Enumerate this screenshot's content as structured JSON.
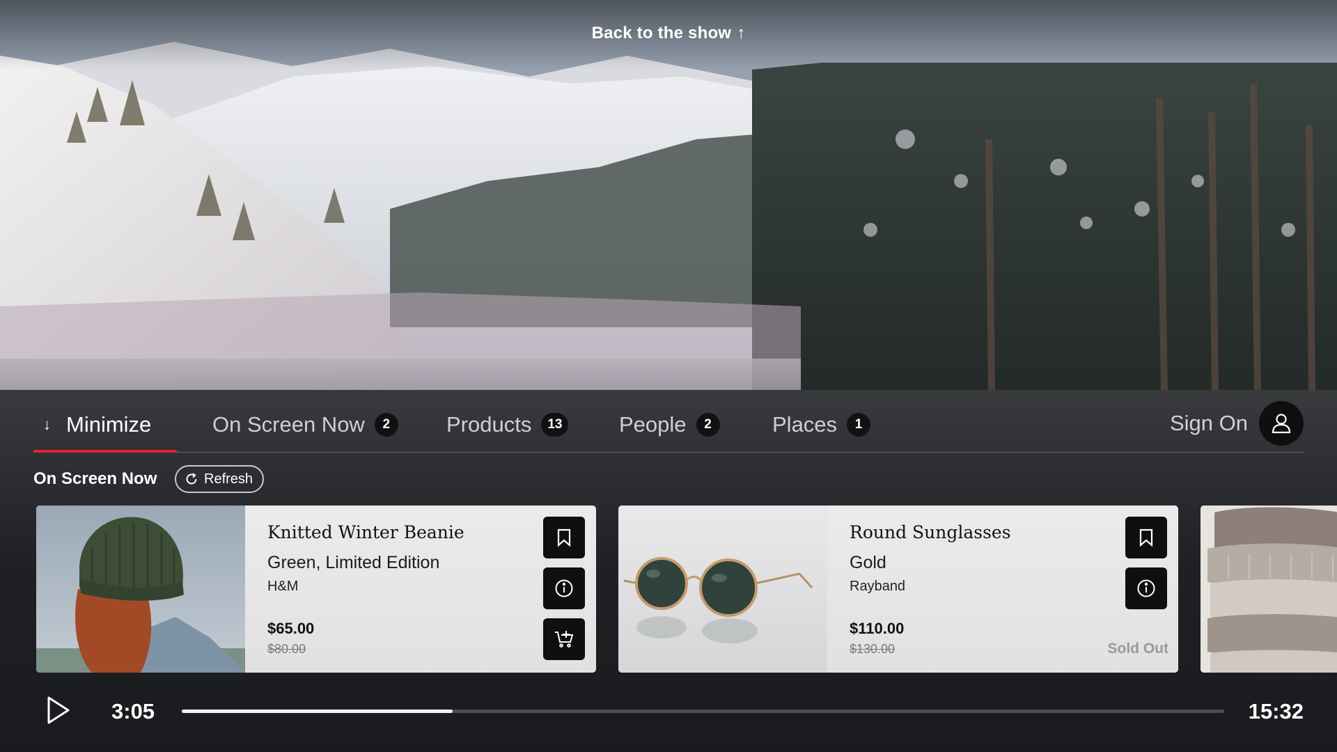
{
  "header": {
    "back_label": "Back to the show",
    "back_icon": "arrow-up-icon"
  },
  "tabs": [
    {
      "label": "Minimize",
      "icon": "arrow-down-icon",
      "active": true
    },
    {
      "label": "On Screen Now",
      "count": "2"
    },
    {
      "label": "Products",
      "count": "13"
    },
    {
      "label": "People",
      "count": "2"
    },
    {
      "label": "Places",
      "count": "1"
    }
  ],
  "account": {
    "sign_on_label": "Sign On",
    "icon": "user-icon"
  },
  "section": {
    "title": "On Screen Now",
    "refresh_label": "Refresh"
  },
  "products": [
    {
      "name": "Knitted Winter Beanie",
      "variant": "Green, Limited Edition",
      "brand": "H&M",
      "price": "$65.00",
      "old_price": "$80.00",
      "actions": [
        "bookmark-icon",
        "info-icon",
        "add-to-cart-icon"
      ]
    },
    {
      "name": "Round Sunglasses",
      "variant": "Gold",
      "brand": "Rayband",
      "price": "$110.00",
      "old_price": "$130.00",
      "status": "Sold Out",
      "actions": [
        "bookmark-icon",
        "info-icon"
      ]
    }
  ],
  "player": {
    "current_time": "3:05",
    "total_time": "15:32",
    "progress": 0.26,
    "play_icon": "play-icon"
  },
  "colors": {
    "accent": "#e0242c",
    "panel": "#2e3034",
    "card": "#e8e7e6"
  }
}
